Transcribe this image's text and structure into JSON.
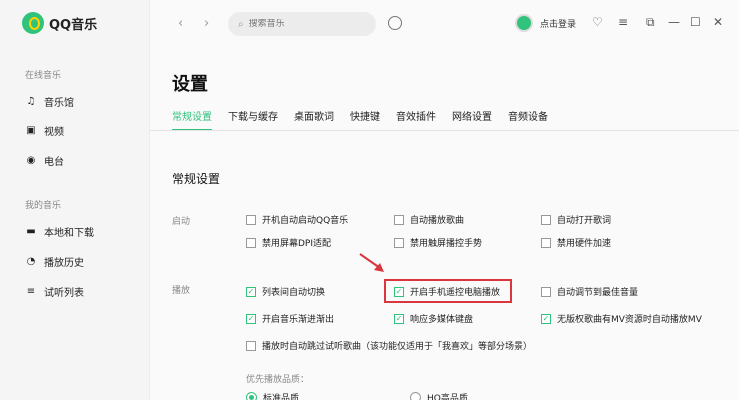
{
  "app": {
    "logo_text": "QQ音乐"
  },
  "sidebar": {
    "online_section": "在线音乐",
    "online_items": [
      {
        "label": "音乐馆",
        "icon": "music-note-icon"
      },
      {
        "label": "视频",
        "icon": "video-icon"
      },
      {
        "label": "电台",
        "icon": "radio-icon"
      }
    ],
    "my_section": "我的音乐",
    "my_items": [
      {
        "label": "本地和下载",
        "icon": "monitor-icon"
      },
      {
        "label": "播放历史",
        "icon": "clock-icon"
      },
      {
        "label": "试听列表",
        "icon": "playlist-icon"
      }
    ]
  },
  "topbar": {
    "search_placeholder": "搜索音乐",
    "login_label": "点击登录"
  },
  "page": {
    "title": "设置",
    "tabs": [
      "常规设置",
      "下载与缓存",
      "桌面歌词",
      "快捷键",
      "音效插件",
      "网络设置",
      "音频设备"
    ],
    "active_tab": 0,
    "section_title": "常规设置"
  },
  "settings": {
    "startup_label": "启动",
    "startup": [
      {
        "label": "开机自动启动QQ音乐",
        "checked": false
      },
      {
        "label": "自动播放歌曲",
        "checked": false
      },
      {
        "label": "自动打开歌词",
        "checked": false
      },
      {
        "label": "禁用屏幕DPI适配",
        "checked": false
      },
      {
        "label": "禁用触屏播控手势",
        "checked": false
      },
      {
        "label": "禁用硬件加速",
        "checked": false
      }
    ],
    "playback_label": "播放",
    "playback": [
      {
        "label": "列表间自动切换",
        "checked": true
      },
      {
        "label": "开启手机遥控电脑播放",
        "checked": true
      },
      {
        "label": "自动调节到最佳音量",
        "checked": false
      },
      {
        "label": "开启音乐渐进渐出",
        "checked": true
      },
      {
        "label": "响应多媒体键盘",
        "checked": true
      },
      {
        "label": "无版权歌曲有MV资源时自动播放MV",
        "checked": true
      },
      {
        "label": "播放时自动跳过试听歌曲（该功能仅适用于「我喜欢」等部分场景）",
        "checked": false
      }
    ],
    "quality_label": "优先播放品质：",
    "quality_options": [
      {
        "label": "标准品质",
        "selected": true
      },
      {
        "label": "HQ高品质",
        "selected": false
      }
    ]
  },
  "colors": {
    "accent": "#31c27c",
    "highlight": "#d9363e"
  }
}
